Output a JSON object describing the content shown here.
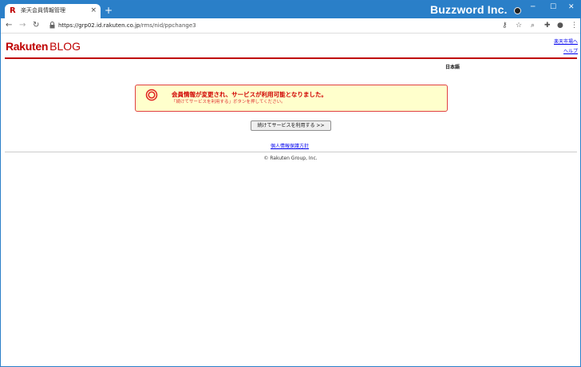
{
  "browser": {
    "tab_title": "楽天会員情報管理",
    "tab_favicon": "R",
    "tab_close": "×",
    "new_tab": "+",
    "brand": "Buzzword Inc.",
    "url_host": "https://grp02.id.rakuten.co.jp",
    "url_path": "/rms/nid/ppchange3",
    "window_controls": [
      "─",
      "☐",
      "✕"
    ]
  },
  "header": {
    "logo_main": "Rakuten",
    "logo_sub": "BLOG",
    "link_ichiba": "楽天市場へ",
    "link_help": "ヘルプ",
    "language": "日本語"
  },
  "notice": {
    "title": "会員情報が変更され、サービスが利用可能となりました。",
    "subtitle": "「続けてサービスを利用する」ボタンを押してください。"
  },
  "main": {
    "continue_label": "続けてサービスを利用する >>",
    "privacy_link": "個人情報保護方針"
  },
  "footer": {
    "copyright": "© Rakuten Group, Inc."
  },
  "colors": {
    "brand_red": "#bf0000",
    "titlebar_blue": "#2a7fc8",
    "notice_bg": "#ffffcc"
  }
}
